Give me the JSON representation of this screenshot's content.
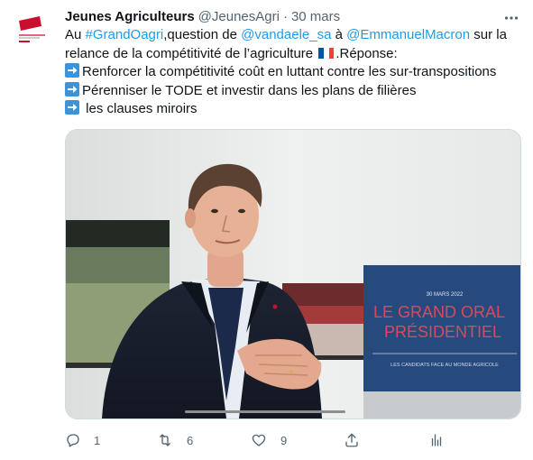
{
  "author": {
    "name": "Jeunes Agriculteurs",
    "handle": "@JeunesAgri",
    "separator": "·",
    "date": "30 mars",
    "avatar_text": "JEUNES AGRICULTEURS"
  },
  "tweet": {
    "l1_a": "Au ",
    "l1_hashtag": "#GrandOagri",
    "l1_b": ",question de ",
    "l1_mention1": "@vandaele_sa",
    "l1_c": " à ",
    "l1_mention2": "@EmmanuelMacron",
    "l1_d": " sur la",
    "l2_a": "relance de la compétitivité de l’agriculture ",
    "l2_b": ".Réponse:",
    "bullet1": "Renforcer la compétitivité coût en luttant contre les sur-transpositions",
    "bullet2": "Pérenniser le TODE et investir dans les plans de filières",
    "bullet3": " les clauses miroirs"
  },
  "media": {
    "backdrop_line1": "LE GRAND ORAL",
    "backdrop_line2": "PRÉSIDENTIEL",
    "backdrop_date": "30 MARS 2022",
    "backdrop_sub": "LES CANDIDATS FACE AU MONDE AGRICOLE"
  },
  "actions": {
    "replies": "1",
    "retweets": "6",
    "likes": "9"
  },
  "colors": {
    "link": "#1d9bf0",
    "secondary": "#536471",
    "backdrop_blue": "#274a7e",
    "backdrop_red": "#c8102e"
  },
  "icons": [
    "more-icon",
    "arrow-right-icon",
    "france-flag-icon",
    "reply-icon",
    "retweet-icon",
    "like-icon",
    "share-icon",
    "analytics-icon"
  ]
}
